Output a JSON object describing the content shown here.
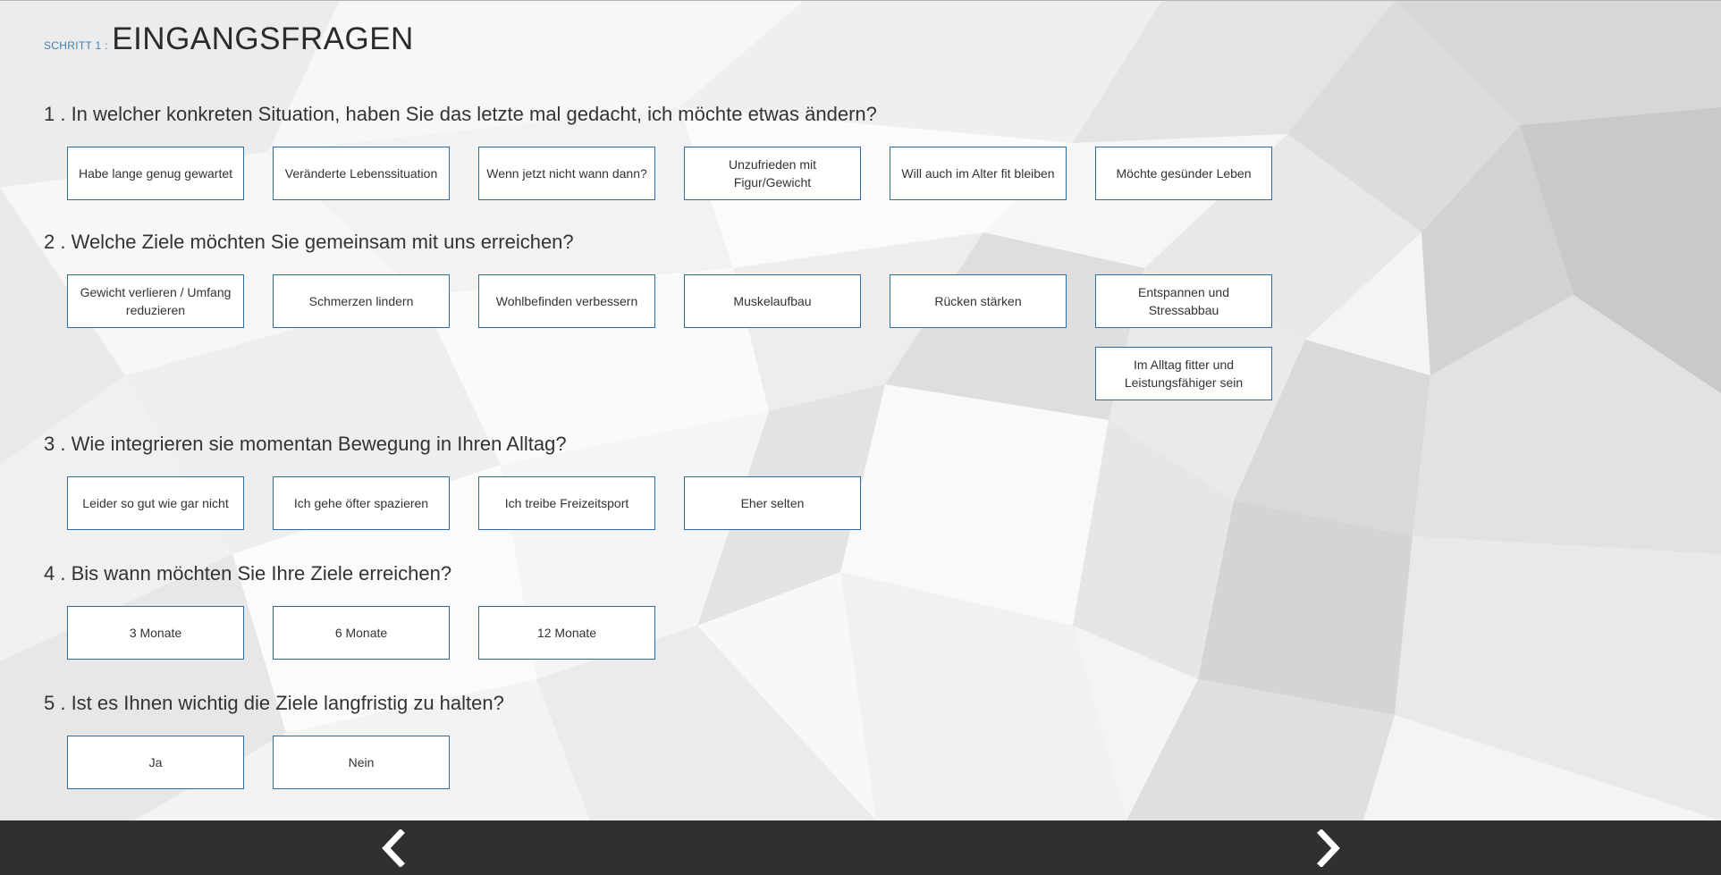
{
  "header": {
    "step_label": "SCHRITT 1 :",
    "title": "EINGANGSFRAGEN"
  },
  "questions": [
    {
      "text": "1 . In welcher konkreten Situation, haben Sie das letzte mal gedacht, ich möchte etwas ändern?",
      "options": [
        "Habe lange genug gewartet",
        "Veränderte Lebenssituation",
        "Wenn jetzt nicht wann dann?",
        "Unzufrieden mit Figur/Gewicht",
        "Will auch im Alter fit bleiben",
        "Möchte gesünder Leben"
      ]
    },
    {
      "text": "2 . Welche Ziele möchten Sie gemeinsam mit uns erreichen?",
      "options": [
        "Gewicht verlieren / Umfang reduzieren",
        "Schmerzen lindern",
        "Wohlbefinden verbessern",
        "Muskelaufbau",
        "Rücken stärken",
        "Entspannen und Stressabbau",
        "Im Alltag fitter und Leistungsfähiger sein"
      ]
    },
    {
      "text": "3 . Wie integrieren sie momentan Bewegung in Ihren Alltag?",
      "options": [
        "Leider so gut wie gar nicht",
        "Ich gehe öfter spazieren",
        "Ich treibe Freizeitsport",
        "Eher selten"
      ]
    },
    {
      "text": "4 . Bis wann möchten Sie Ihre Ziele erreichen?",
      "options": [
        "3 Monate",
        "6 Monate",
        "12 Monate"
      ]
    },
    {
      "text": "5 . Ist es Ihnen wichtig die Ziele langfristig zu halten?",
      "options": [
        "Ja",
        "Nein"
      ]
    }
  ],
  "footer": {
    "prev_icon": "chevron-left-icon",
    "next_icon": "chevron-right-icon"
  },
  "colors": {
    "accent": "#2e6da4",
    "step_label": "#3a7fb5",
    "footer_bg": "#303030"
  }
}
